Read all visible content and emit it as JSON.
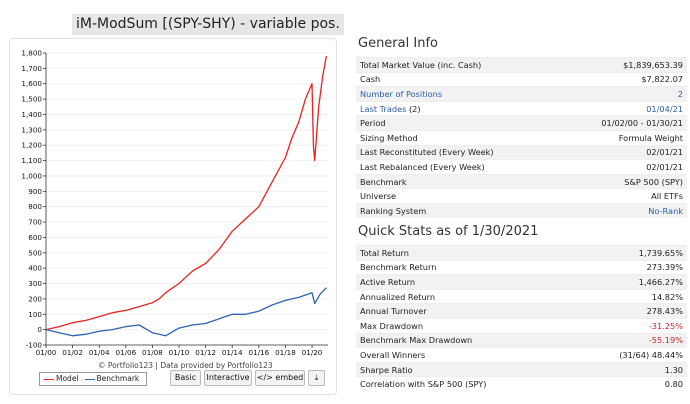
{
  "title": "iM-ModSum [(SPY-SHY) - variable pos.",
  "chart_data": {
    "type": "line",
    "x_ticks": [
      "01/00",
      "01/02",
      "01/04",
      "01/06",
      "01/08",
      "01/10",
      "01/12",
      "01/14",
      "01/16",
      "01/18",
      "01/20"
    ],
    "y_ticks": [
      -100,
      0,
      100,
      200,
      300,
      400,
      500,
      600,
      700,
      800,
      900,
      "1,000",
      "1,100",
      "1,200",
      "1,300",
      "1,400",
      "1,500",
      "1,600",
      "1,700",
      "1,800"
    ],
    "ylim": [
      -100,
      1800
    ],
    "series": [
      {
        "name": "Model",
        "color": "#e8231f",
        "x": [
          2000,
          2001,
          2002,
          2003,
          2004,
          2005,
          2006,
          2007,
          2008,
          2008.5,
          2009,
          2010,
          2011,
          2012,
          2013,
          2014,
          2015,
          2016,
          2017,
          2018,
          2018.5,
          2019,
          2019.5,
          2020,
          2020.1,
          2020.2,
          2020.5,
          2020.8,
          2021.08
        ],
        "y": [
          0,
          20,
          45,
          60,
          85,
          110,
          125,
          150,
          175,
          200,
          240,
          300,
          380,
          430,
          520,
          640,
          720,
          800,
          960,
          1120,
          1250,
          1350,
          1500,
          1600,
          1200,
          1100,
          1450,
          1650,
          1780
        ]
      },
      {
        "name": "Benchmark",
        "color": "#2d63b7",
        "x": [
          2000,
          2001,
          2002,
          2003,
          2004,
          2005,
          2006,
          2007,
          2008,
          2009,
          2009.2,
          2010,
          2011,
          2012,
          2013,
          2014,
          2015,
          2016,
          2017,
          2018,
          2019,
          2020,
          2020.2,
          2020.6,
          2021.08
        ],
        "y": [
          0,
          -20,
          -40,
          -30,
          -10,
          0,
          20,
          30,
          -20,
          -40,
          -30,
          10,
          30,
          40,
          70,
          100,
          100,
          120,
          160,
          190,
          210,
          240,
          170,
          230,
          273
        ]
      }
    ]
  },
  "credit": "© Portfolio123 | Data provided by Portfolio123",
  "buttons": {
    "basic": "Basic",
    "interactive": "Interactive",
    "embed": "</> embed",
    "download": "⤓"
  },
  "general": {
    "heading": "General Info",
    "rows": [
      {
        "label": "Total Market Value (inc. Cash)",
        "value": "$1,839,653.39"
      },
      {
        "label": "Cash",
        "value": "$7,822.07"
      },
      {
        "label": "Number of Positions",
        "value": "2"
      },
      {
        "label": "Last Trades",
        "extra": " (2)",
        "value": "01/04/21"
      },
      {
        "label": "Period",
        "value": "01/02/00 - 01/30/21"
      },
      {
        "label": "Sizing Method",
        "value": "Formula Weight"
      },
      {
        "label": "Last Reconstituted (Every Week)",
        "value": "02/01/21"
      },
      {
        "label": "Last Rebalanced (Every Week)",
        "value": "02/01/21"
      },
      {
        "label": "Benchmark",
        "value": "S&P 500 (SPY)"
      },
      {
        "label": "Universe",
        "value": "All ETFs"
      },
      {
        "label": "Ranking System",
        "value": "No-Rank"
      }
    ]
  },
  "quick": {
    "heading": "Quick Stats as of 1/30/2021",
    "rows": [
      {
        "label": "Total Return",
        "value": "1,739.65%"
      },
      {
        "label": "Benchmark Return",
        "value": "273.39%"
      },
      {
        "label": "Active Return",
        "value": "1,466.27%"
      },
      {
        "label": "Annualized Return",
        "value": "14.82%"
      },
      {
        "label": "Annual Turnover",
        "value": "278.43%"
      },
      {
        "label": "Max Drawdown",
        "value": "-31.25%"
      },
      {
        "label": "Benchmark Max Drawdown",
        "value": "-55.19%"
      },
      {
        "label": "Overall Winners",
        "value": "(31/64) 48.44%"
      },
      {
        "label": "Sharpe Ratio",
        "value": "1.30"
      },
      {
        "label": "Correlation with S&P 500 (SPY)",
        "value": "0.80"
      }
    ]
  }
}
